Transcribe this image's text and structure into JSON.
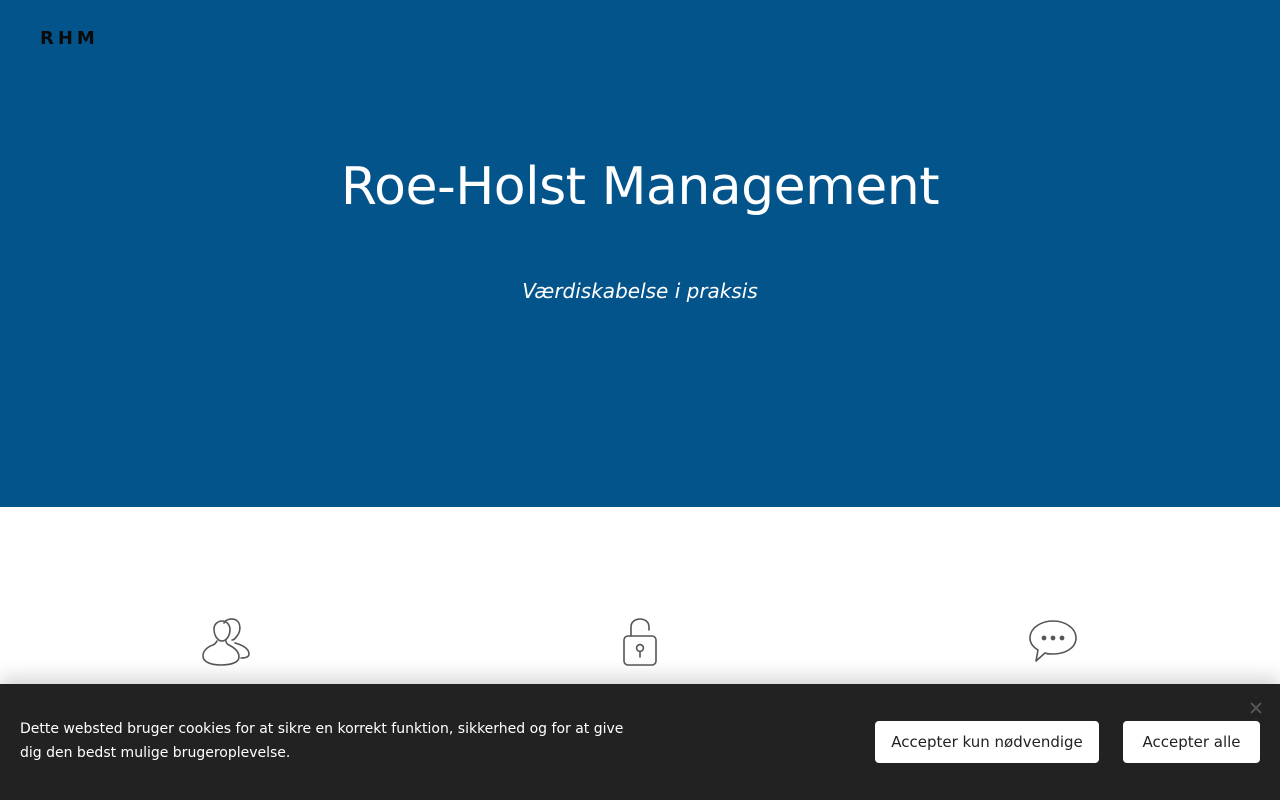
{
  "header": {
    "logo_text": "RHM"
  },
  "hero": {
    "title": "Roe-Holst Management",
    "subtitle": "Værdiskabelse i praksis",
    "background_color": "#04548c"
  },
  "features": {
    "icons": [
      "people-icon",
      "lock-icon",
      "chat-icon"
    ],
    "icon_color": "#555555"
  },
  "cookie_banner": {
    "message": "Dette websted bruger cookies for at sikre en korrekt funktion, sikkerhed og for at give dig den bedst mulige brugeroplevelse.",
    "accept_necessary_label": "Accepter kun nødvendige",
    "accept_all_label": "Accepter alle",
    "close_icon": "close-icon",
    "background_color": "#222222"
  }
}
